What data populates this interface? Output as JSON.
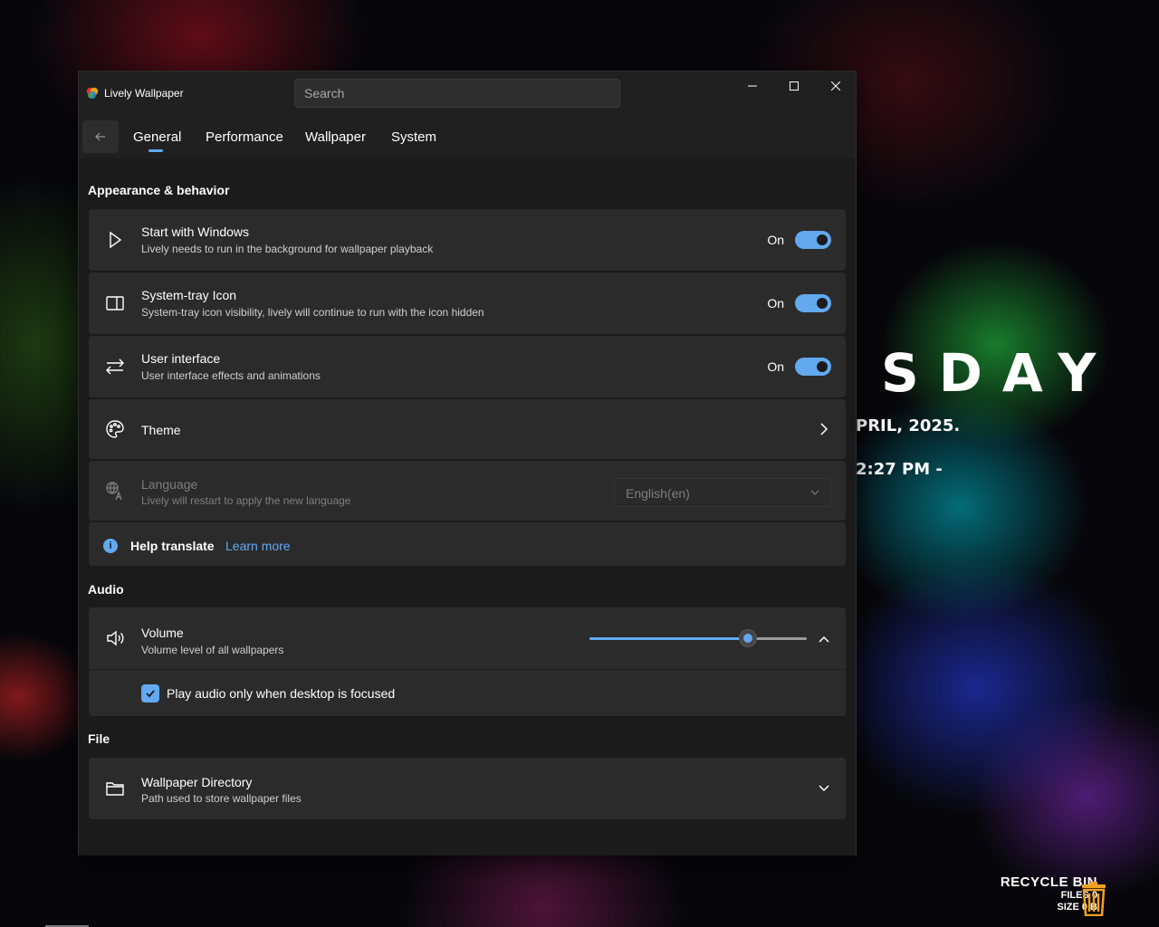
{
  "desktop": {
    "clock": {
      "day": "SDAY",
      "date": "PRIL, 2025.",
      "time": "2:27 PM -"
    },
    "recycle_bin": {
      "title": "RECYCLE BIN",
      "files": "FILES 0",
      "size": "SIZE 0 B"
    }
  },
  "window": {
    "title": "Lively Wallpaper",
    "search_placeholder": "Search",
    "tabs": [
      {
        "label": "General",
        "selected": true
      },
      {
        "label": "Performance"
      },
      {
        "label": "Wallpaper"
      },
      {
        "label": "System"
      }
    ],
    "sections": {
      "appearance": {
        "title": "Appearance & behavior",
        "start_with_windows": {
          "title": "Start with Windows",
          "desc": "Lively needs to run in the background for wallpaper playback",
          "state": "On"
        },
        "system_tray": {
          "title": "System-tray Icon",
          "desc": "System-tray icon visibility, lively will continue to run with the icon hidden",
          "state": "On"
        },
        "user_interface": {
          "title": "User interface",
          "desc": "User interface effects and animations",
          "state": "On"
        },
        "theme": {
          "title": "Theme"
        },
        "language": {
          "title": "Language",
          "desc": "Lively will restart to apply the new language",
          "value": "English(en)"
        },
        "help": {
          "title": "Help translate",
          "link": "Learn more",
          "info_glyph": "i"
        }
      },
      "audio": {
        "title": "Audio",
        "volume": {
          "title": "Volume",
          "desc": "Volume level of all wallpapers",
          "level": 0.73
        },
        "focus_checkbox": {
          "label": "Play audio only when desktop is focused",
          "checked": true
        }
      },
      "file": {
        "title": "File",
        "directory": {
          "title": "Wallpaper Directory",
          "desc": "Path used to store wallpaper files"
        }
      }
    }
  },
  "colors": {
    "accent": "#62a9f0",
    "window_bg": "#202020",
    "card_bg": "#2b2b2b"
  }
}
